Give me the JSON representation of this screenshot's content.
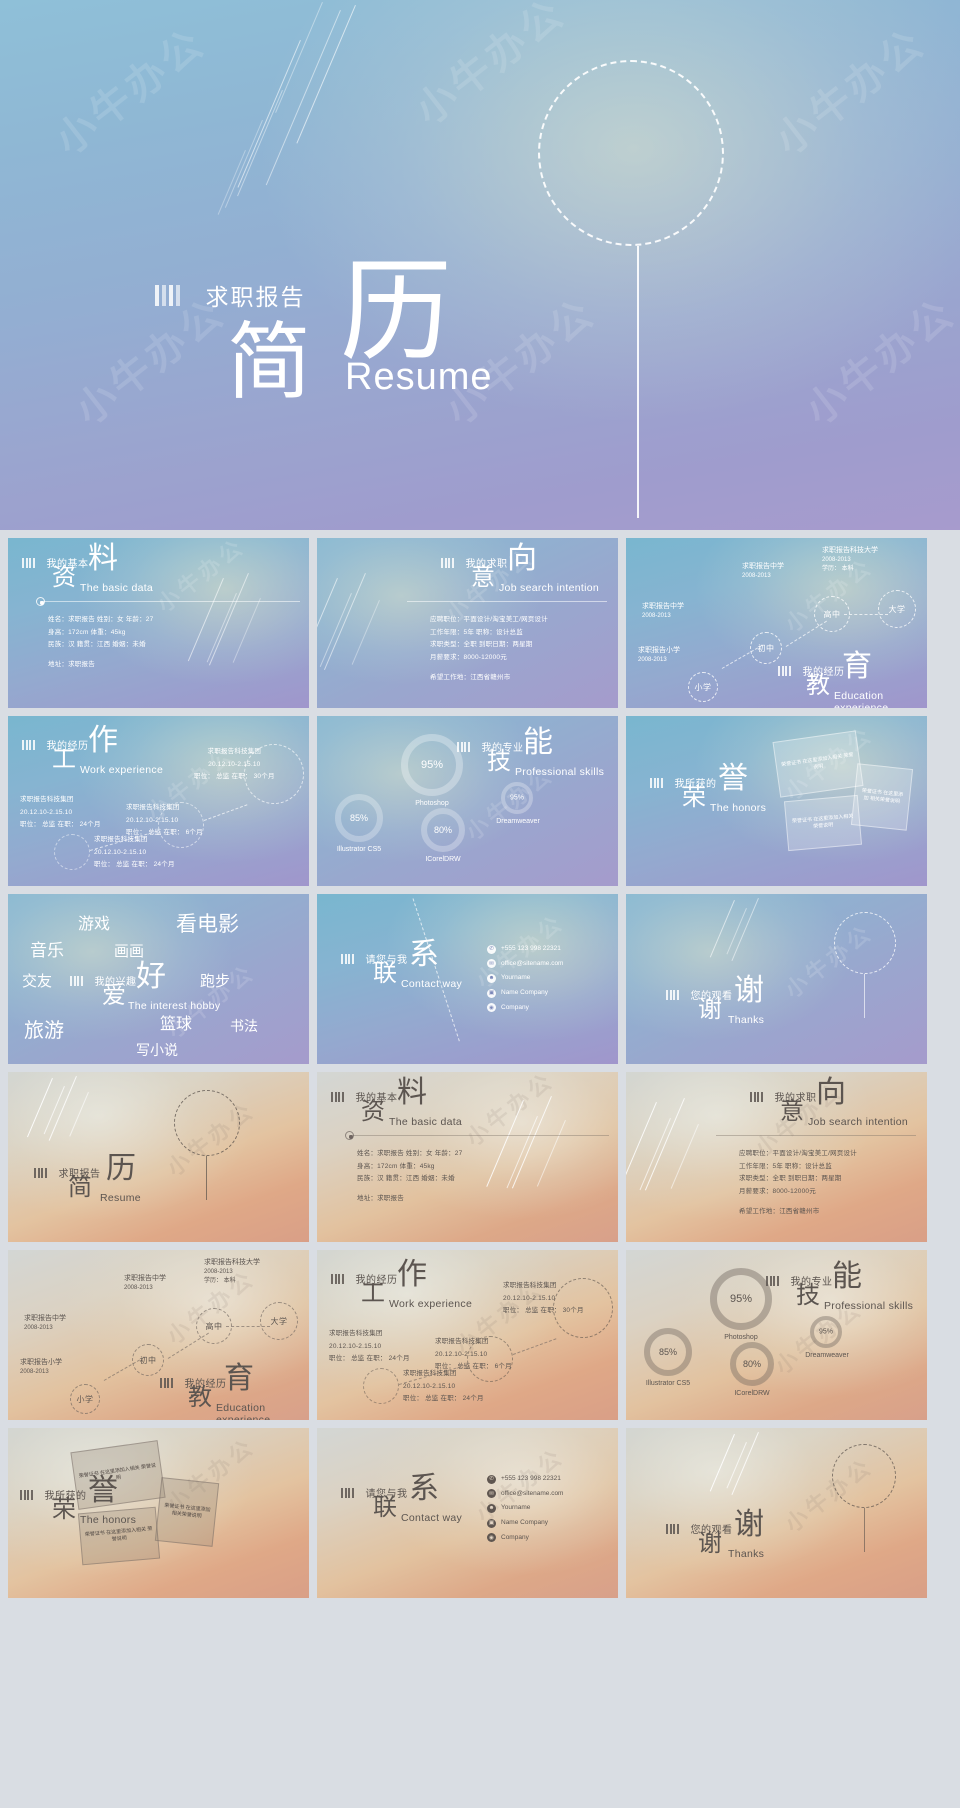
{
  "cover": {
    "bars_icon": "four-bars-icon",
    "sub_cn": "求职报告",
    "big_1": "历",
    "big_2": "简",
    "en": "Resume",
    "watermark": "小牛办公"
  },
  "slides": [
    {
      "id": "basic-data",
      "theme": "cool",
      "bars_icon": "four-bars-icon",
      "sub_cn": "我的基本",
      "big": "料",
      "big2": "资",
      "en": "The basic data",
      "info": [
        "姓名：求职报告      姓别：女      年龄：27",
        "身高：172cm      体重：45kg",
        "民族：汉      籍贯：江西      婚姻：未婚",
        "",
        "地址：求职报告"
      ]
    },
    {
      "id": "job-intention",
      "theme": "cool",
      "bars_icon": "four-bars-icon",
      "sub_cn": "我的求职",
      "big": "向",
      "big2": "意",
      "en": "Job search intention",
      "info": [
        "应聘职位：平面设计/淘宝美工/网页设计",
        "工作年限：5年        职称：设计总监",
        "求职类型：全职      到职日期：两星期",
        "月薪要求：8000-12000元",
        "",
        "希望工作地：江西省赣州市"
      ]
    },
    {
      "id": "education-experience",
      "theme": "cool",
      "bars_icon": "four-bars-icon",
      "sub_cn": "我的经历",
      "big": "育",
      "big2": "教",
      "en": "Education experience",
      "nodes": [
        {
          "label": "小学",
          "title": "求职报告小学",
          "years": "2008-2013"
        },
        {
          "label": "初中",
          "title": "求职报告中学",
          "years": "2008-2013"
        },
        {
          "label": "高中",
          "title": "求职报告中学",
          "years": "2008-2013"
        },
        {
          "label": "大学",
          "title": "求职报告科技大学",
          "years": "2008-2013",
          "extra": "学历： 本科"
        }
      ]
    },
    {
      "id": "work-experience",
      "theme": "cool",
      "bars_icon": "four-bars-icon",
      "sub_cn": "我的经历",
      "big": "作",
      "big2": "工",
      "en": "Work experience",
      "entries": [
        {
          "company": "求职报告科技集团",
          "period": "20.12.10-2.15.10",
          "detail": "职位： 总监     在职： 30个月"
        },
        {
          "company": "求职报告科技集团",
          "period": "20.12.10-2.15.10",
          "detail": "职位： 总监     在职： 24个月"
        },
        {
          "company": "求职报告科技集团",
          "period": "20.12.10-2.15.10",
          "detail": "职位： 总监     在职： 6个月"
        },
        {
          "company": "求职报告科技集团",
          "period": "20.12.10-2.15.10",
          "detail": "职位： 总监     在职： 24个月"
        }
      ]
    },
    {
      "id": "professional-skills",
      "theme": "cool",
      "bars_icon": "four-bars-icon",
      "sub_cn": "我的专业",
      "big": "能",
      "big2": "技",
      "en": "Professional skills",
      "rings": [
        {
          "value": "95%",
          "label": "Photoshop"
        },
        {
          "value": "85%",
          "label": "Illustrator CS5"
        },
        {
          "value": "80%",
          "label": "ICorelDRW"
        },
        {
          "value": "95%",
          "label": "Dreamweaver"
        }
      ]
    },
    {
      "id": "honors",
      "theme": "cool",
      "bars_icon": "four-bars-icon",
      "sub_cn": "我所获的",
      "big": "誉",
      "big2": "荣",
      "en": "The honors",
      "certs": [
        "荣誉证书\n在这里添加入相关\n荣誉说明",
        "荣誉证书\n在这里添加\n相关荣誉说明",
        "荣誉证书\n在这里添加入相关\n荣誉说明"
      ]
    },
    {
      "id": "interest-hobby",
      "theme": "cool",
      "bars_icon": "four-bars-icon",
      "sub_cn": "我的兴趣",
      "big": "好",
      "big2": "爱",
      "en": "The interest hobby",
      "hobbies": [
        "游戏",
        "看电影",
        "音乐",
        "画画",
        "交友",
        "跑步",
        "旅游",
        "篮球",
        "书法",
        "写小说"
      ]
    },
    {
      "id": "contact-way",
      "theme": "cool",
      "bars_icon": "four-bars-icon",
      "sub_cn": "请您与我",
      "big": "系",
      "big2": "联",
      "en": "Contact way",
      "contacts": [
        {
          "icon": "phone-icon",
          "glyph": "✆",
          "text": "+555 123 998 22321"
        },
        {
          "icon": "mail-icon",
          "glyph": "✉",
          "text": "office@sitename.com"
        },
        {
          "icon": "user-icon",
          "glyph": "☻",
          "text": "Yourname"
        },
        {
          "icon": "building-icon",
          "glyph": "▣",
          "text": "Name Company"
        },
        {
          "icon": "globe-icon",
          "glyph": "◉",
          "text": "Company"
        }
      ]
    },
    {
      "id": "thanks",
      "theme": "cool",
      "bars_icon": "four-bars-icon",
      "sub_cn": "您的观看",
      "big": "谢",
      "big2": "谢",
      "en": "Thanks"
    },
    {
      "id": "cover-warm",
      "theme": "warm",
      "bars_icon": "four-bars-icon",
      "sub_cn": "求职报告",
      "big": "历",
      "big2": "简",
      "en": "Resume"
    },
    {
      "id": "basic-data-warm",
      "theme": "warm",
      "bars_icon": "four-bars-icon",
      "sub_cn": "我的基本",
      "big": "料",
      "big2": "资",
      "en": "The basic data",
      "info": [
        "姓名：求职报告      姓别：女      年龄：27",
        "身高：172cm      体重：45kg",
        "民族：汉      籍贯：江西      婚姻：未婚",
        "",
        "地址：求职报告"
      ]
    },
    {
      "id": "job-intention-warm",
      "theme": "warm",
      "bars_icon": "four-bars-icon",
      "sub_cn": "我的求职",
      "big": "向",
      "big2": "意",
      "en": "Job search intention",
      "info": [
        "应聘职位：平面设计/淘宝美工/网页设计",
        "工作年限：5年        职称：设计总监",
        "求职类型：全职      到职日期：两星期",
        "月薪要求：8000-12000元",
        "",
        "希望工作地：江西省赣州市"
      ]
    },
    {
      "id": "education-experience-warm",
      "theme": "warm",
      "bars_icon": "four-bars-icon",
      "sub_cn": "我的经历",
      "big": "育",
      "big2": "教",
      "en": "Education experience",
      "nodes": [
        {
          "label": "小学",
          "title": "求职报告小学",
          "years": "2008-2013"
        },
        {
          "label": "初中",
          "title": "求职报告中学",
          "years": "2008-2013"
        },
        {
          "label": "高中",
          "title": "求职报告中学",
          "years": "2008-2013"
        },
        {
          "label": "大学",
          "title": "求职报告科技大学",
          "years": "2008-2013",
          "extra": "学历： 本科"
        }
      ]
    },
    {
      "id": "work-experience-warm",
      "theme": "warm",
      "bars_icon": "four-bars-icon",
      "sub_cn": "我的经历",
      "big": "作",
      "big2": "工",
      "en": "Work experience",
      "entries": [
        {
          "company": "求职报告科技集团",
          "period": "20.12.10-2.15.10",
          "detail": "职位： 总监     在职： 30个月"
        },
        {
          "company": "求职报告科技集团",
          "period": "20.12.10-2.15.10",
          "detail": "职位： 总监     在职： 24个月"
        },
        {
          "company": "求职报告科技集团",
          "period": "20.12.10-2.15.10",
          "detail": "职位： 总监     在职： 6个月"
        },
        {
          "company": "求职报告科技集团",
          "period": "20.12.10-2.15.10",
          "detail": "职位： 总监     在职： 24个月"
        }
      ]
    },
    {
      "id": "professional-skills-warm",
      "theme": "warm",
      "bars_icon": "four-bars-icon",
      "sub_cn": "我的专业",
      "big": "能",
      "big2": "技",
      "en": "Professional skills",
      "rings": [
        {
          "value": "95%",
          "label": "Photoshop"
        },
        {
          "value": "85%",
          "label": "Illustrator CS5"
        },
        {
          "value": "80%",
          "label": "ICorelDRW"
        },
        {
          "value": "95%",
          "label": "Dreamweaver"
        }
      ]
    },
    {
      "id": "honors-warm",
      "theme": "warm",
      "bars_icon": "four-bars-icon",
      "sub_cn": "我所获的",
      "big": "誉",
      "big2": "荣",
      "en": "The honors",
      "certs": [
        "荣誉证书\n在这里添加入相关\n荣誉说明",
        "荣誉证书\n在这里添加\n相关荣誉说明",
        "荣誉证书\n在这里添加入相关\n荣誉说明"
      ]
    },
    {
      "id": "contact-way-warm",
      "theme": "warm",
      "bars_icon": "four-bars-icon",
      "sub_cn": "请您与我",
      "big": "系",
      "big2": "联",
      "en": "Contact way",
      "contacts": [
        {
          "icon": "phone-icon",
          "glyph": "✆",
          "text": "+555 123 998 22321"
        },
        {
          "icon": "mail-icon",
          "glyph": "✉",
          "text": "office@sitename.com"
        },
        {
          "icon": "user-icon",
          "glyph": "☻",
          "text": "Yourname"
        },
        {
          "icon": "building-icon",
          "glyph": "▣",
          "text": "Name Company"
        },
        {
          "icon": "globe-icon",
          "glyph": "◉",
          "text": "Company"
        }
      ]
    },
    {
      "id": "thanks-warm",
      "theme": "warm",
      "bars_icon": "four-bars-icon",
      "sub_cn": "您的观看",
      "big": "谢",
      "big2": "谢",
      "en": "Thanks"
    }
  ],
  "colors": {
    "cool_start": "#8fc0d8",
    "cool_end": "#a79bcd",
    "warm_start": "#d3d6d4",
    "warm_end": "#d8a08a",
    "text_light": "#ffffff",
    "text_dark": "#5c5550"
  }
}
